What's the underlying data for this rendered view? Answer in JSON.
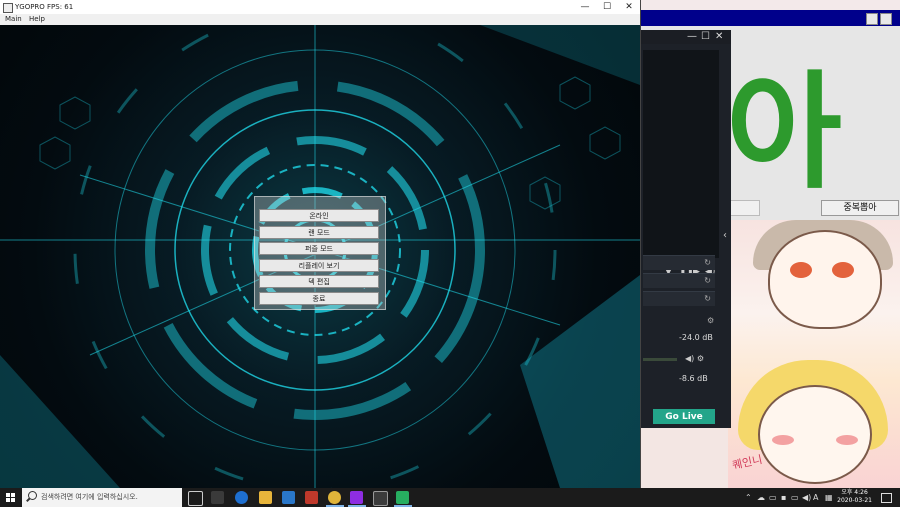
{
  "ygopro": {
    "title": "YGOPRO FPS: 61",
    "menu": [
      "Main",
      "Help"
    ],
    "controls": {
      "minimize": "—",
      "maximize": "☐",
      "close": "✕"
    },
    "main_menu": [
      "온라인",
      "랜 모드",
      "퍼즐 모드",
      "리플레이 보기",
      "덱 편집",
      "종료"
    ]
  },
  "right_app": {
    "big_text": "아",
    "roll_button": "중복뽑아",
    "anime_text": "퀘인니"
  },
  "obs": {
    "controls": {
      "minimize": "—",
      "maximize": "☐",
      "close": "✕"
    },
    "collapse": "‹",
    "audio": [
      {
        "level": "-24.0 dB"
      },
      {
        "level": "-8.6 dB"
      }
    ],
    "go_live": "Go Live"
  },
  "taskbar": {
    "search_placeholder": "검색하려면 여기에 입력하십시오.",
    "tray_lang": "A",
    "time": "오후 4:26",
    "date": "2020-03-21"
  }
}
